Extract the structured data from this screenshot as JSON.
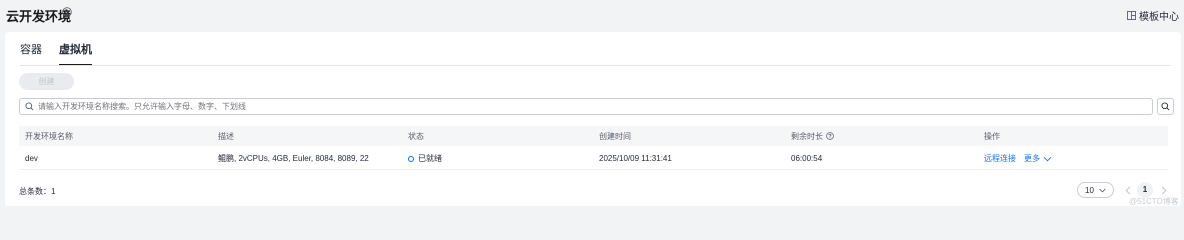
{
  "header": {
    "title": "云开发环境",
    "template_center": "模板中心"
  },
  "tabs": [
    {
      "label": "容器"
    },
    {
      "label": "虚拟机"
    }
  ],
  "toolbar": {
    "create_label": "创建"
  },
  "search": {
    "placeholder": "请输入开发环境名称搜索。只允许输入字母、数字、下划线"
  },
  "table": {
    "headers": [
      "开发环境名称",
      "描述",
      "状态",
      "创建时间",
      "剩余时长",
      "操作"
    ],
    "rows": [
      {
        "name": "dev",
        "description": "鲲鹏, 2vCPUs, 4GB, Euler, 8084, 8089, 22",
        "status": "已就绪",
        "created": "2025/10/09 11:31:41",
        "remaining": "06:00:54",
        "action_connect": "远程连接",
        "action_more": "更多"
      }
    ]
  },
  "footer": {
    "total": "总条数：1",
    "page_size": "10",
    "current_page": "1"
  },
  "watermark": "@51CTO博客",
  "colors": {
    "accent": "#1971e6",
    "status": "#0b6dde"
  }
}
